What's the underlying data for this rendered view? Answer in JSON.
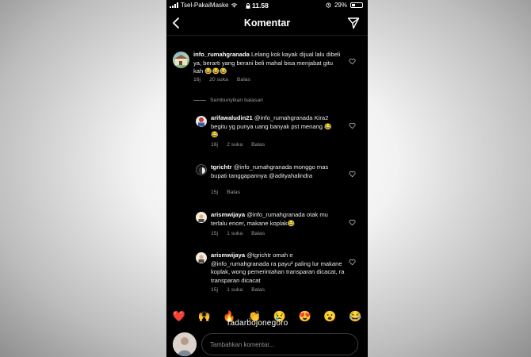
{
  "status_bar": {
    "carrier": "Tsel-PakaiMaske",
    "time": "11.58",
    "battery": "29%"
  },
  "header": {
    "title": "Komentar",
    "back_icon": "chevron-left-icon",
    "send_icon": "direct-send-icon"
  },
  "main_comment": {
    "username": "info_rumahgranada",
    "text": "Lelang kok kayak dijual lalu dibeli ya, berarti yang berani beli mahal bisa menjabat gitu kah 😂😂😂",
    "age": "16j",
    "likes": "20 suka",
    "reply": "Balas"
  },
  "hide_replies": "Sembunyikan balasan",
  "replies": [
    {
      "username": "arifawaludin21",
      "text": "@info_rumahgranada Kira2 begitu yg punya uang banyak pst menang 😂😂",
      "age": "16j",
      "likes": "2 suka",
      "reply": "Balas"
    },
    {
      "username": "tgrichtr",
      "text": "@info_rumahgranada monggo mas bupati tanggapannya @adityahalindra",
      "age": "15j",
      "likes": "",
      "reply": "Balas"
    },
    {
      "username": "arismwijaya",
      "text": "@info_rumahgranada otak mu terlalu encer, makane koplak😂",
      "age": "15j",
      "likes": "1 suka",
      "reply": "Balas"
    },
    {
      "username": "arismwijaya",
      "text": "@tgrichtr omah e @info_rumahgranada ra payu² paling lur makane koplak, wong pemerintahan transparan dicacat, ra transparan dicacat",
      "age": "15j",
      "likes": "1 suka",
      "reply": "Balas"
    }
  ],
  "emoji_bar": [
    "❤️",
    "🙌",
    "🔥",
    "👏",
    "😢",
    "😍",
    "😮",
    "😂"
  ],
  "watermark": "radarbojonegoro",
  "composer": {
    "placeholder": "Tambahkan komentar..."
  }
}
